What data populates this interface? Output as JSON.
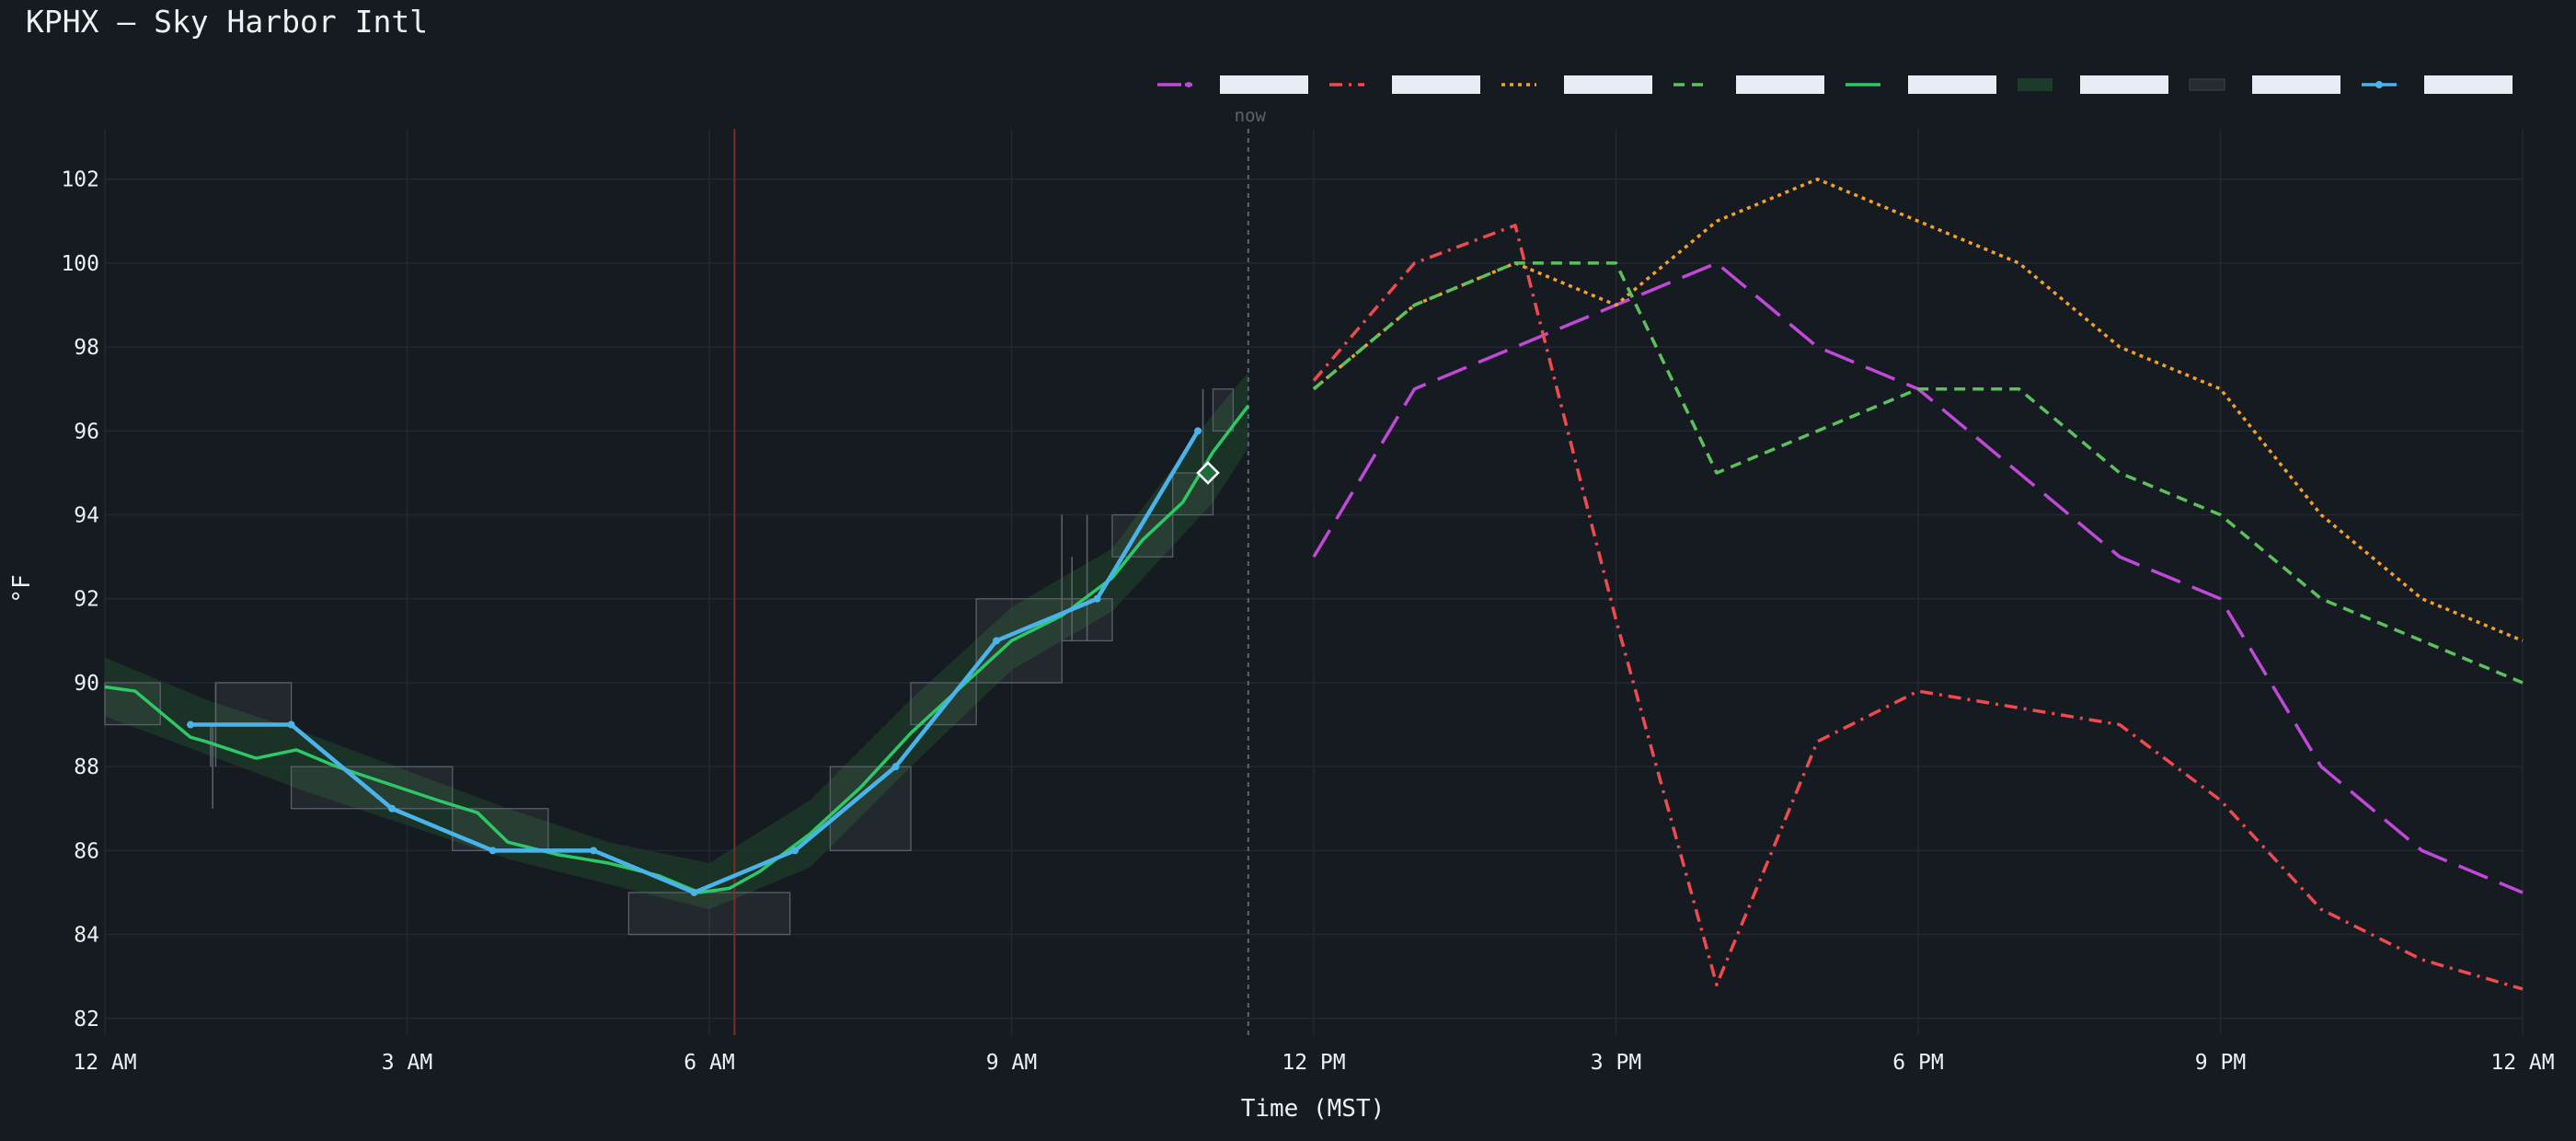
{
  "title": "KPHX — Sky Harbor Intl",
  "chart_data": {
    "type": "line",
    "xlabel": "Time (MST)",
    "ylabel": "°F",
    "now_label": "now",
    "xlim": [
      0,
      24
    ],
    "ylim": [
      81.6,
      103.2
    ],
    "grid": true,
    "legend": "top-right",
    "x_ticks": [
      {
        "x": 0,
        "label": "12 AM"
      },
      {
        "x": 3,
        "label": "3 AM"
      },
      {
        "x": 6,
        "label": "6 AM"
      },
      {
        "x": 9,
        "label": "9 AM"
      },
      {
        "x": 12,
        "label": "12 PM"
      },
      {
        "x": 15,
        "label": "3 PM"
      },
      {
        "x": 18,
        "label": "6 PM"
      },
      {
        "x": 21,
        "label": "9 PM"
      },
      {
        "x": 24,
        "label": "12 AM"
      }
    ],
    "y_ticks": [
      82,
      84,
      86,
      88,
      90,
      92,
      94,
      96,
      98,
      100,
      102
    ],
    "now_x": 11.35,
    "sunrise_x": 6.25,
    "marker": {
      "x": 10.95,
      "y": 95,
      "shape": "diamond"
    },
    "colors": {
      "background": "#161a21",
      "grid": "#232831",
      "now_line": "#5c6370",
      "sunrise_line": "#7a2e2a",
      "purple": "#c04ad8",
      "red": "#ef4a4e",
      "orange": "#f2a226",
      "green_dashed": "#5cc15c",
      "green_obs": "#2ec866",
      "band": "#1d3b2a",
      "box": "#3a404a",
      "blue": "#4ab4ea"
    },
    "series": [
      {
        "style": "purple-longdash",
        "color": "#c04ad8",
        "x": [
          12,
          13,
          14,
          15,
          16,
          17,
          18,
          19,
          20,
          21,
          22,
          23,
          24
        ],
        "y": [
          93,
          97,
          98,
          99,
          100,
          98,
          97,
          95,
          93,
          92,
          88,
          86,
          85
        ]
      },
      {
        "style": "red-dashdot",
        "color": "#ef4a4e",
        "x": [
          12,
          13,
          14,
          15,
          16,
          17,
          18,
          19,
          20,
          21,
          22,
          23,
          24
        ],
        "y": [
          97.2,
          100,
          100.9,
          91.5,
          82.8,
          88.6,
          89.8,
          89.4,
          89,
          87.2,
          84.6,
          83.4,
          82.7
        ]
      },
      {
        "style": "orange-dotted",
        "color": "#f2a226",
        "x": [
          12,
          13,
          14,
          15,
          16,
          17,
          18,
          19,
          20,
          21,
          22,
          23,
          24
        ],
        "y": [
          97,
          99,
          100,
          99,
          101,
          102,
          101,
          100,
          98,
          97,
          94,
          92,
          91
        ]
      },
      {
        "style": "green-dashed",
        "color": "#5cc15c",
        "x": [
          12,
          13,
          14,
          15,
          16,
          17,
          18,
          19,
          20,
          21,
          22,
          23,
          24
        ],
        "y": [
          97,
          99,
          100,
          100,
          95,
          96,
          97,
          97,
          95,
          94,
          92,
          91,
          90
        ]
      },
      {
        "style": "green-observed",
        "color": "#2ec866",
        "x": [
          0,
          0.3,
          0.5,
          0.85,
          1.0,
          1.5,
          1.9,
          2.3,
          2.8,
          3.3,
          3.7,
          4.0,
          4.5,
          5.0,
          5.5,
          5.9,
          6.2,
          6.5,
          7.0,
          7.5,
          8.0,
          8.5,
          9.0,
          9.5,
          10.0,
          10.3,
          10.7,
          11.0,
          11.35
        ],
        "y": [
          89.9,
          89.8,
          89.4,
          88.7,
          88.6,
          88.2,
          88.4,
          88,
          87.6,
          87.2,
          86.9,
          86.2,
          85.9,
          85.7,
          85.4,
          85.0,
          85.1,
          85.5,
          86.4,
          87.5,
          88.8,
          89.9,
          91.0,
          91.6,
          92.5,
          93.4,
          94.3,
          95.5,
          96.6
        ]
      },
      {
        "style": "green-band",
        "color": "#1d3b2a",
        "x": [
          0,
          1,
          2,
          3,
          4,
          5,
          6,
          7,
          8,
          9,
          10,
          11,
          11.35
        ],
        "y_low": [
          89.2,
          88.3,
          87.4,
          86.6,
          85.8,
          85.2,
          84.6,
          85.6,
          88.0,
          90.3,
          91.7,
          94.3,
          95.6
        ],
        "y_high": [
          90.6,
          89.6,
          88.8,
          87.9,
          87.0,
          86.2,
          85.7,
          87.2,
          89.6,
          91.8,
          93.2,
          96.4,
          97.4
        ]
      },
      {
        "style": "gray-boxes",
        "color": "#3a404a",
        "boxes": [
          {
            "x0": 0,
            "x1": 0.55,
            "y0": 89,
            "y1": 90
          },
          {
            "x0": 1.1,
            "x1": 1.85,
            "y0": 89,
            "y1": 90
          },
          {
            "x0": 1.85,
            "x1": 3.45,
            "y0": 87,
            "y1": 88
          },
          {
            "x0": 3.45,
            "x1": 4.4,
            "y0": 86,
            "y1": 87
          },
          {
            "x0": 5.2,
            "x1": 6.8,
            "y0": 84,
            "y1": 85
          },
          {
            "x0": 7.2,
            "x1": 8.0,
            "y0": 86,
            "y1": 88
          },
          {
            "x0": 8.0,
            "x1": 8.65,
            "y0": 89,
            "y1": 90
          },
          {
            "x0": 8.65,
            "x1": 9.5,
            "y0": 90,
            "y1": 92
          },
          {
            "x0": 9.5,
            "x1": 10.0,
            "y0": 91,
            "y1": 92
          },
          {
            "x0": 10.0,
            "x1": 10.6,
            "y0": 93,
            "y1": 94
          },
          {
            "x0": 10.6,
            "x1": 11.0,
            "y0": 94,
            "y1": 95
          },
          {
            "x0": 11.0,
            "x1": 11.2,
            "y0": 96,
            "y1": 97
          }
        ],
        "spikes": [
          {
            "x": 1.05,
            "y0": 88,
            "y1": 89
          },
          {
            "x": 1.07,
            "y0": 87,
            "y1": 89
          },
          {
            "x": 1.1,
            "y0": 88,
            "y1": 90
          },
          {
            "x": 9.5,
            "y0": 91,
            "y1": 94
          },
          {
            "x": 9.6,
            "y0": 91,
            "y1": 93
          },
          {
            "x": 9.75,
            "y0": 91,
            "y1": 94
          },
          {
            "x": 10.9,
            "y0": 95,
            "y1": 97
          }
        ]
      },
      {
        "style": "blue-markers",
        "color": "#4ab4ea",
        "x": [
          0.85,
          1.85,
          2.85,
          3.85,
          4.85,
          5.85,
          6.85,
          7.85,
          8.85,
          9.85,
          10.85
        ],
        "y": [
          89,
          89,
          87,
          86,
          86,
          85,
          86,
          88,
          91,
          92,
          96
        ]
      }
    ]
  }
}
